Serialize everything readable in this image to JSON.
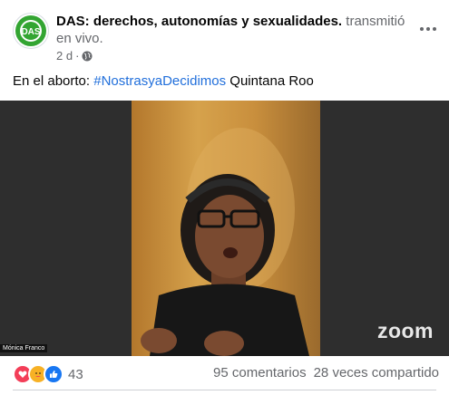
{
  "page": {
    "name": "DAS: derechos, autonomías y sexualidades.",
    "action": " transmitió en vivo.",
    "time": "2 d",
    "dot": "·",
    "avatar_text": "DAS"
  },
  "post": {
    "text_before": "En el aborto: ",
    "hashtag": "#NostrasyaDecidimos",
    "text_after": " Quintana Roo"
  },
  "video": {
    "watermark": "zoom",
    "name_tag": "Mónica Franco"
  },
  "footer": {
    "reaction_count": "43",
    "comments": "95 comentarios",
    "shares": "28 veces compartido"
  },
  "colors": {
    "link": "#216fdb",
    "like": "#1877f2",
    "love": "#f33e58",
    "care": "#f7b125",
    "avatar_green": "#33a532"
  }
}
